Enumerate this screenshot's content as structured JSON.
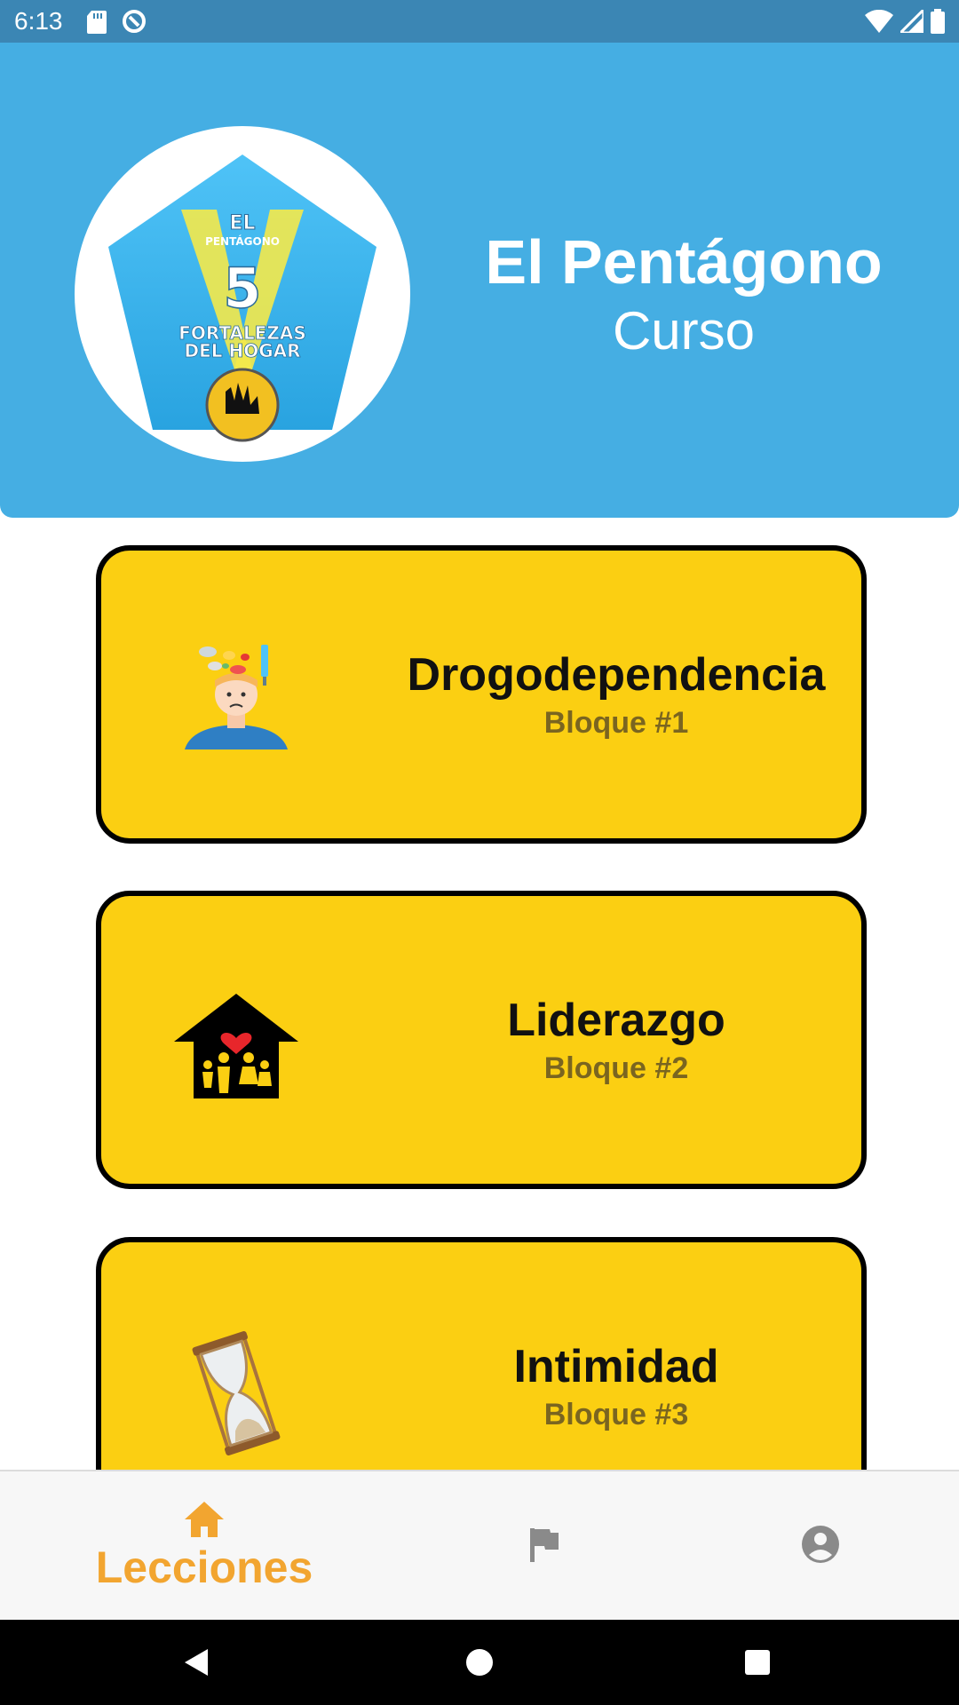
{
  "status_bar": {
    "time": "6:13"
  },
  "header": {
    "title": "El Pentágono",
    "subtitle": "Curso"
  },
  "lessons": [
    {
      "title": "Drogodependencia",
      "subtitle": "Bloque #1",
      "icon": "drug-dependence-icon"
    },
    {
      "title": "Liderazgo",
      "subtitle": "Bloque #2",
      "icon": "family-house-icon"
    },
    {
      "title": "Intimidad",
      "subtitle": "Bloque #3",
      "icon": "hourglass-icon"
    }
  ],
  "bottom_nav": {
    "home_label": "Lecciones",
    "active_color": "#f2a530",
    "inactive_color": "#8a8a8a"
  },
  "colors": {
    "status_bar": "#3b86b4",
    "header": "#45aee3",
    "card": "#fbcf12"
  }
}
